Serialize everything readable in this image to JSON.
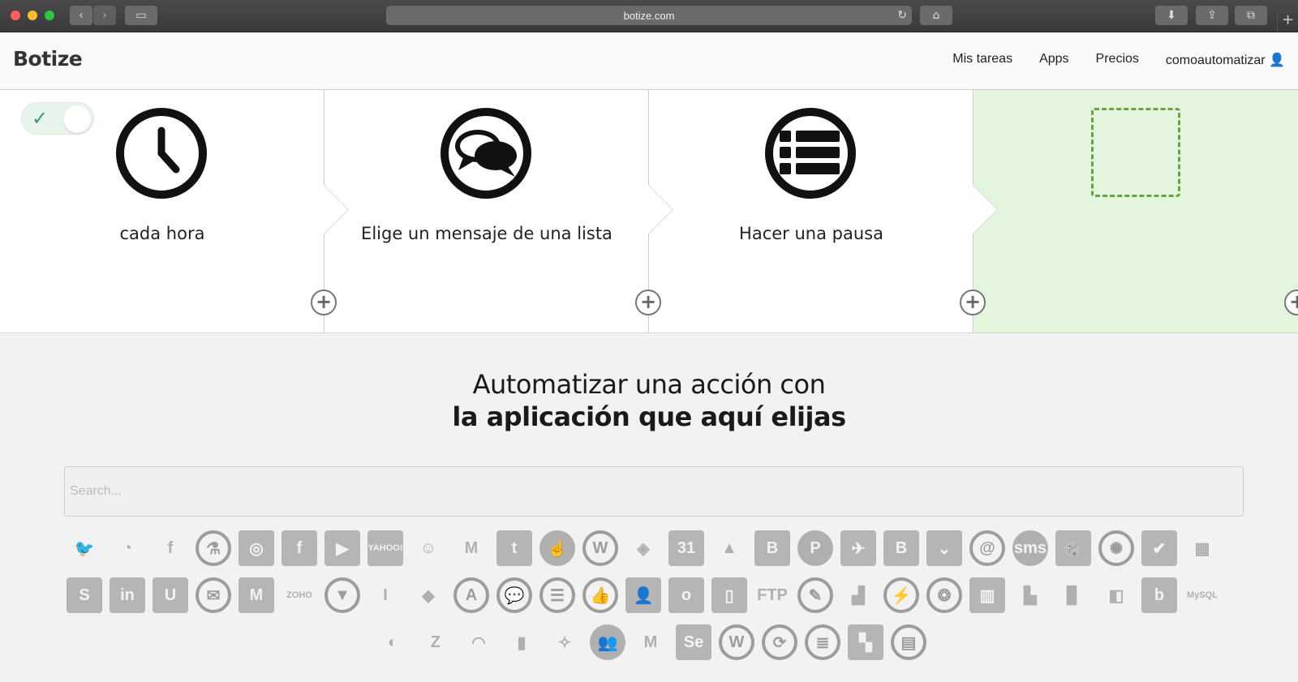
{
  "browser": {
    "url": "botize.com"
  },
  "header": {
    "brand": "Botize",
    "nav": [
      "Mis tareas",
      "Apps",
      "Precios",
      "comoautomatizar"
    ]
  },
  "workflow": {
    "steps": [
      {
        "label": "cada hora",
        "icon": "clock-icon"
      },
      {
        "label": "Elige un mensaje de una lista",
        "icon": "chat-bubbles-icon"
      },
      {
        "label": "Hacer una pausa",
        "icon": "list-icon"
      }
    ],
    "toggle_on": true
  },
  "panel": {
    "headline_line1": "Automatizar una acción con",
    "headline_line2": "la aplicación que aquí elijas",
    "search_placeholder": "Search..."
  },
  "apps": {
    "row1": [
      {
        "name": "twitter",
        "glyph": "🐦",
        "style": "plain"
      },
      {
        "name": "rss",
        "glyph": "◔",
        "style": "plain"
      },
      {
        "name": "facebook-comments",
        "glyph": "f",
        "style": "plain"
      },
      {
        "name": "lab",
        "glyph": "⚗",
        "style": "circ"
      },
      {
        "name": "instagram",
        "glyph": "◎",
        "style": "sq"
      },
      {
        "name": "facebook",
        "glyph": "f",
        "style": "sq"
      },
      {
        "name": "youtube",
        "glyph": "▶",
        "style": "sq"
      },
      {
        "name": "yahoo-weather",
        "glyph": "YAHOO!",
        "style": "sq"
      },
      {
        "name": "jenkins",
        "glyph": "☺",
        "style": "plain"
      },
      {
        "name": "gmail",
        "glyph": "M",
        "style": "plain"
      },
      {
        "name": "tumblr",
        "glyph": "t",
        "style": "sq"
      },
      {
        "name": "touch",
        "glyph": "☝",
        "style": "circfill"
      },
      {
        "name": "wordpress-xmlrpc",
        "glyph": "W",
        "style": "circ"
      },
      {
        "name": "dropbox",
        "glyph": "◈",
        "style": "plain"
      },
      {
        "name": "calendar",
        "glyph": "31",
        "style": "sq"
      },
      {
        "name": "google-drive",
        "glyph": "▲",
        "style": "plain"
      },
      {
        "name": "blogger",
        "glyph": "B",
        "style": "sq"
      },
      {
        "name": "pinterest",
        "glyph": "P",
        "style": "circfill"
      },
      {
        "name": "pushpin",
        "glyph": "✈",
        "style": "sq"
      },
      {
        "name": "botize",
        "glyph": "B",
        "style": "sq"
      },
      {
        "name": "pocket",
        "glyph": "⌄",
        "style": "sq"
      },
      {
        "name": "email-at",
        "glyph": "@",
        "style": "circ"
      },
      {
        "name": "sms",
        "glyph": "sms",
        "style": "circfill"
      },
      {
        "name": "evernote",
        "glyph": "🐘",
        "style": "sq"
      },
      {
        "name": "webhooks",
        "glyph": "✺",
        "style": "circ"
      },
      {
        "name": "todo",
        "glyph": "✔",
        "style": "sq"
      },
      {
        "name": "spreadsheet",
        "glyph": "▦",
        "style": "plain"
      }
    ],
    "row2": [
      {
        "name": "swarm",
        "glyph": "S",
        "style": "sq"
      },
      {
        "name": "linkedin",
        "glyph": "in",
        "style": "sq"
      },
      {
        "name": "magnet",
        "glyph": "U",
        "style": "sq"
      },
      {
        "name": "mail",
        "glyph": "✉",
        "style": "circ"
      },
      {
        "name": "gmail-alt",
        "glyph": "M",
        "style": "sq"
      },
      {
        "name": "zoho-projects",
        "glyph": "ZOHO",
        "style": "plain"
      },
      {
        "name": "filter",
        "glyph": "▼",
        "style": "circ"
      },
      {
        "name": "instapaper",
        "glyph": "I",
        "style": "plain"
      },
      {
        "name": "cube",
        "glyph": "◆",
        "style": "plain"
      },
      {
        "name": "typography",
        "glyph": "A",
        "style": "circ"
      },
      {
        "name": "chat",
        "glyph": "💬",
        "style": "circ"
      },
      {
        "name": "list",
        "glyph": "☰",
        "style": "circ"
      },
      {
        "name": "like",
        "glyph": "👍",
        "style": "circ"
      },
      {
        "name": "contacts",
        "glyph": "👤",
        "style": "sq"
      },
      {
        "name": "outlook",
        "glyph": "o",
        "style": "sq"
      },
      {
        "name": "document",
        "glyph": "▯",
        "style": "sq"
      },
      {
        "name": "ftp",
        "glyph": "FTP",
        "style": "plain"
      },
      {
        "name": "brush",
        "glyph": "✎",
        "style": "circ"
      },
      {
        "name": "analytics",
        "glyph": "▟",
        "style": "plain"
      },
      {
        "name": "messenger",
        "glyph": "⚡",
        "style": "circ"
      },
      {
        "name": "dots",
        "glyph": "❂",
        "style": "circ"
      },
      {
        "name": "trello",
        "glyph": "▥",
        "style": "sq"
      },
      {
        "name": "blocks",
        "glyph": "▙",
        "style": "plain"
      },
      {
        "name": "bars",
        "glyph": "▊",
        "style": "plain"
      },
      {
        "name": "aws",
        "glyph": "◧",
        "style": "plain"
      },
      {
        "name": "bing",
        "glyph": "b",
        "style": "sq"
      },
      {
        "name": "mysql",
        "glyph": "MySQL",
        "style": "plain"
      }
    ],
    "row3": [
      {
        "name": "elastic",
        "glyph": "◐",
        "style": "plain"
      },
      {
        "name": "zendesk",
        "glyph": "Z",
        "style": "plain"
      },
      {
        "name": "rainbow",
        "glyph": "◠",
        "style": "plain"
      },
      {
        "name": "pages",
        "glyph": "▮",
        "style": "plain"
      },
      {
        "name": "compass",
        "glyph": "✧",
        "style": "plain"
      },
      {
        "name": "group",
        "glyph": "👥",
        "style": "circfill"
      },
      {
        "name": "marketo",
        "glyph": "M",
        "style": "plain"
      },
      {
        "name": "selenium",
        "glyph": "Se",
        "style": "sq"
      },
      {
        "name": "wordpress",
        "glyph": "W",
        "style": "circ"
      },
      {
        "name": "sync",
        "glyph": "⟳",
        "style": "circ"
      },
      {
        "name": "doc-list",
        "glyph": "≣",
        "style": "circ"
      },
      {
        "name": "delicious",
        "glyph": "▚",
        "style": "sq"
      },
      {
        "name": "newsfeed",
        "glyph": "▤",
        "style": "circ"
      }
    ]
  }
}
